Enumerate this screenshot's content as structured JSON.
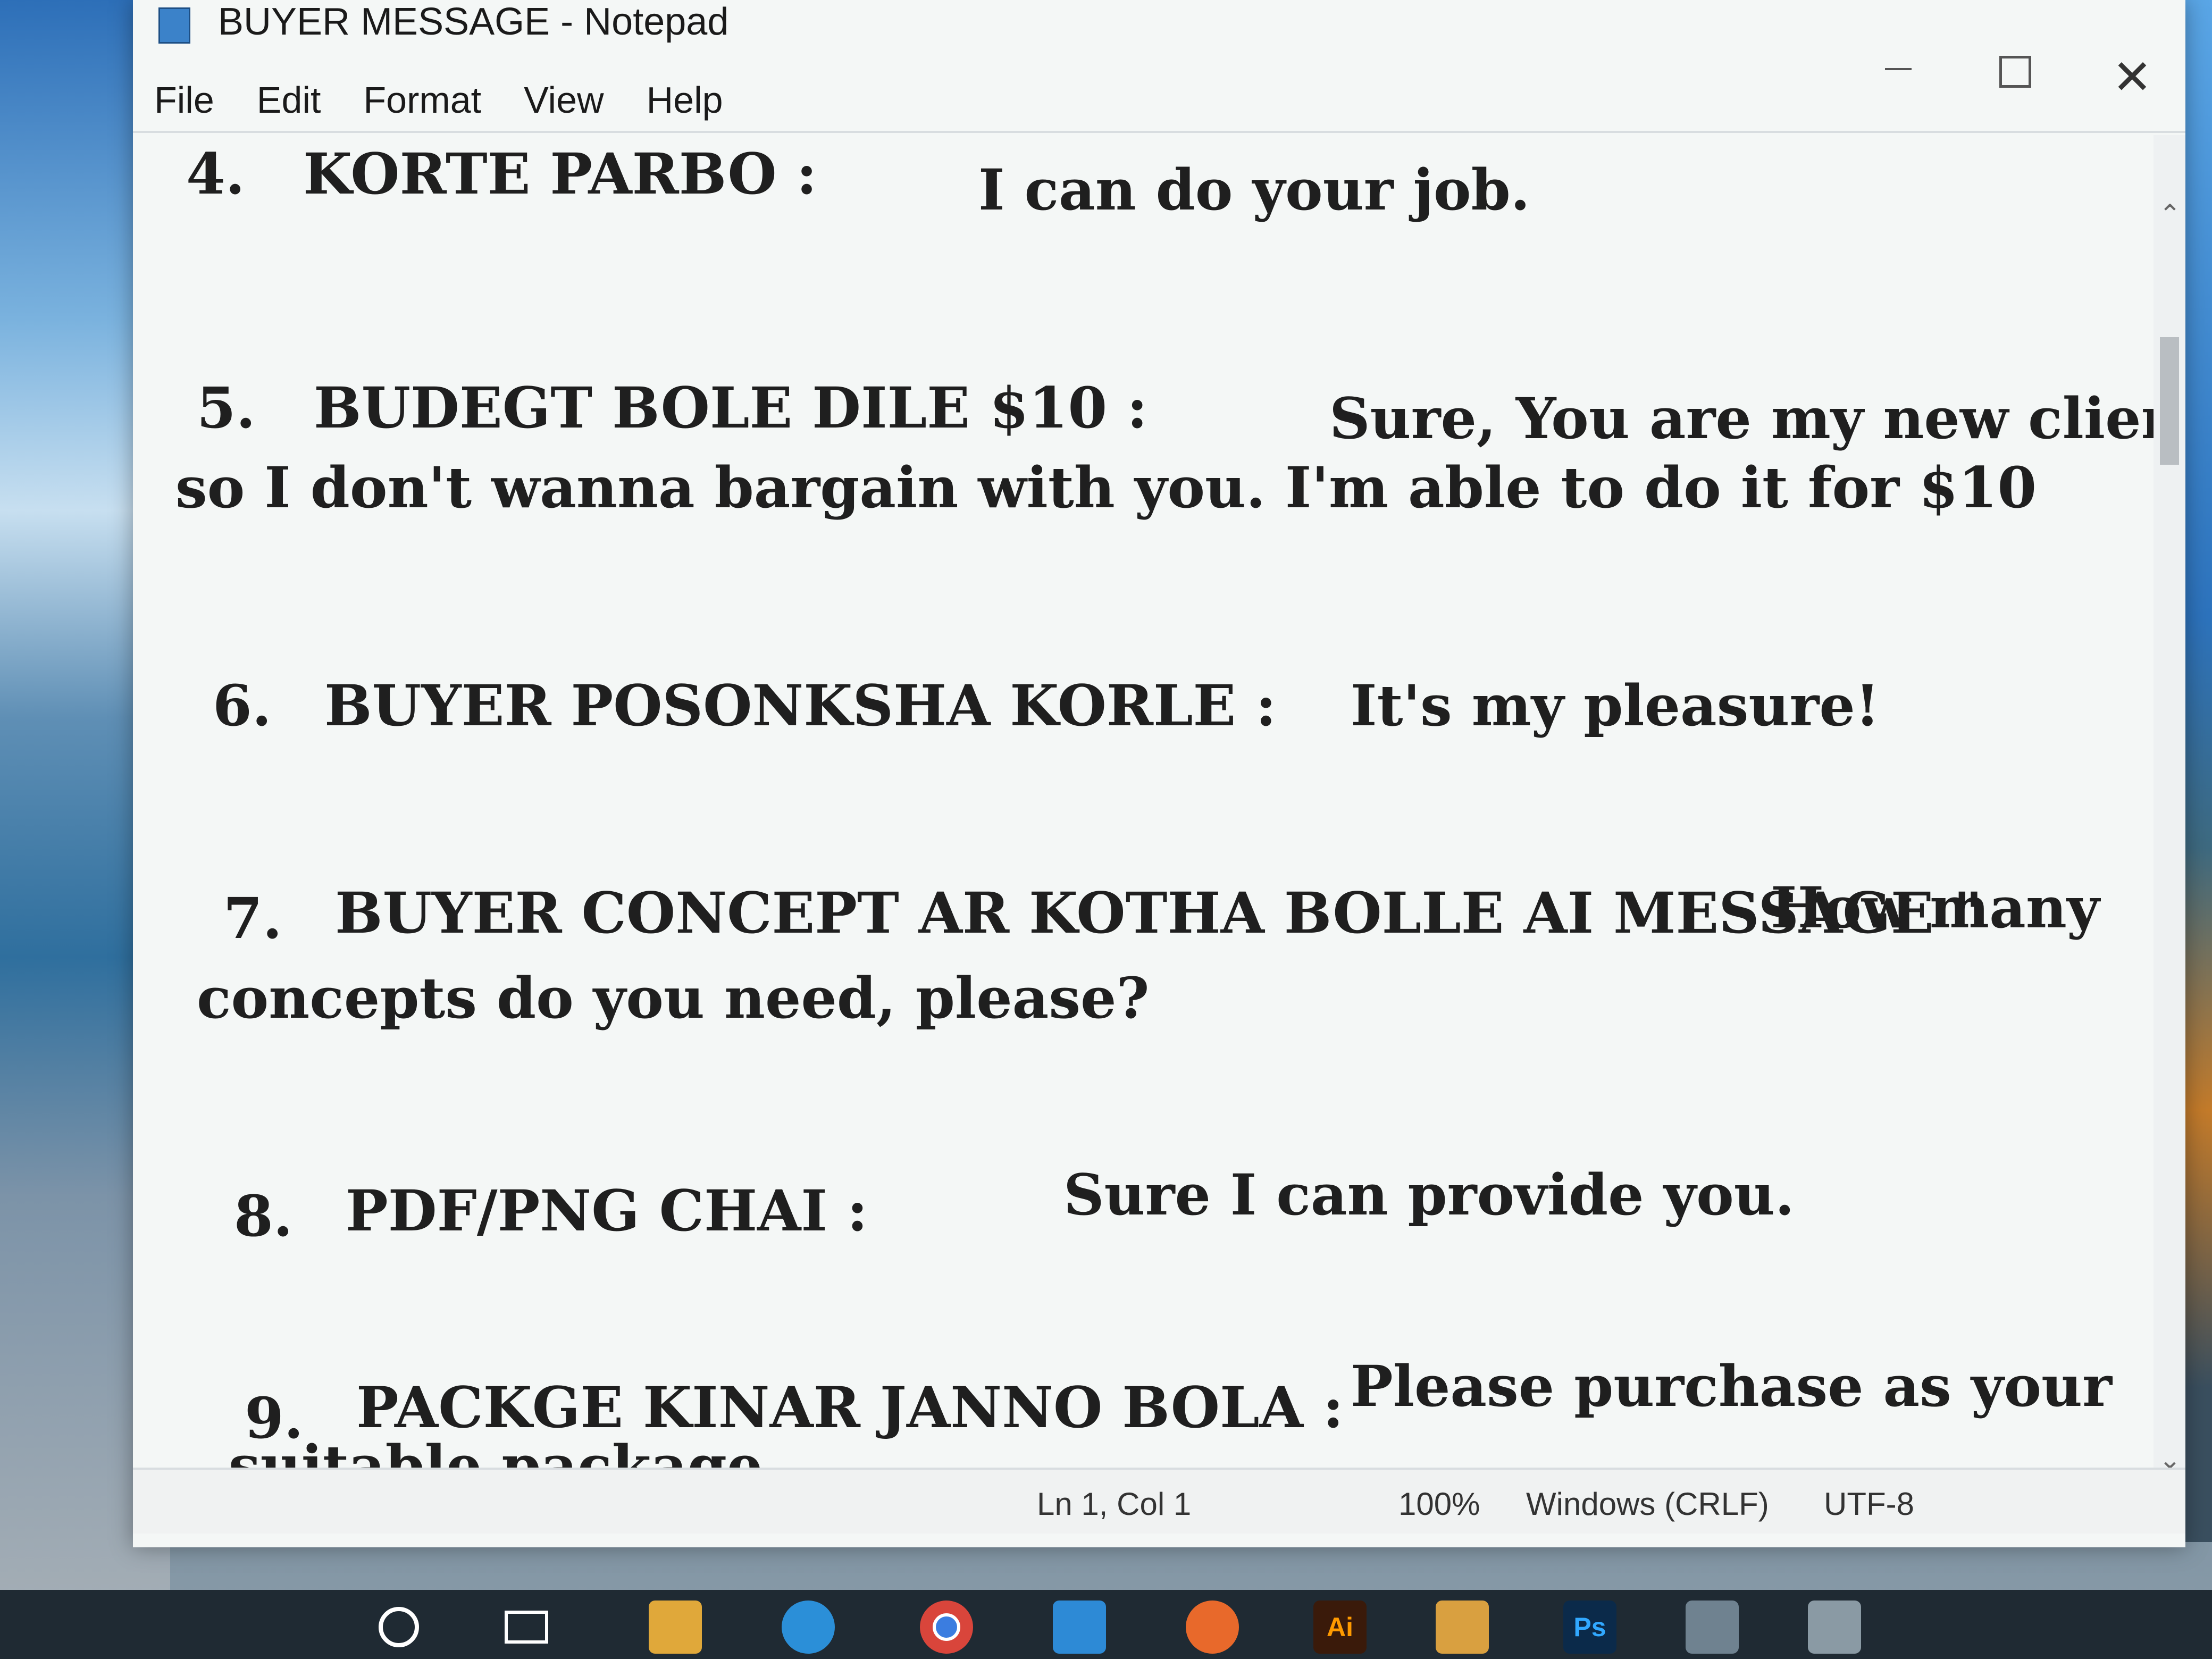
{
  "window": {
    "title": "BUYER MESSAGE - Notepad",
    "controls": {
      "minimize": "—",
      "maximize": "☐",
      "close": "✕"
    }
  },
  "menu": [
    "File",
    "Edit",
    "Format",
    "View",
    "Help"
  ],
  "editor": {
    "lines": [
      {
        "num": "4.",
        "label": "KORTE PARBO :",
        "reply": "I can do your job."
      },
      {
        "num": "5.",
        "label": "BUDEGT BOLE DILE $10   :",
        "reply": "Sure, You are my new client,",
        "cont": "so I don't wanna bargain with you. I'm able to do it for $10"
      },
      {
        "num": "6.",
        "label": "BUYER POSONKSHA KORLE  :",
        "reply": "It's my pleasure!"
      },
      {
        "num": "7.",
        "label": "BUYER CONCEPT AR KOTHA BOLLE AI MESSAGE  \"",
        "reply": "How many",
        "cont": "concepts do you need, please?"
      },
      {
        "num": "8.",
        "label": "PDF/PNG CHAI :",
        "reply": "Sure I can provide you."
      },
      {
        "num": "9.",
        "label": "PACKGE KINAR JANNO BOLA :",
        "reply": "Please purchase as your",
        "cont": "suitable package"
      }
    ]
  },
  "statusbar": {
    "position": "Ln 1, Col 1",
    "zoom": "100%",
    "line_ending": "Windows (CRLF)",
    "encoding": "UTF-8"
  },
  "taskbar": {
    "icons": [
      "search-icon",
      "task-view-icon",
      "file-explorer-icon",
      "edge-icon",
      "chrome-icon",
      "mail-icon",
      "firefox-icon",
      "illustrator-icon",
      "store-icon",
      "photoshop-icon",
      "app-icon",
      "app-icon"
    ],
    "ai_label": "Ai",
    "ps_label": "Ps"
  }
}
